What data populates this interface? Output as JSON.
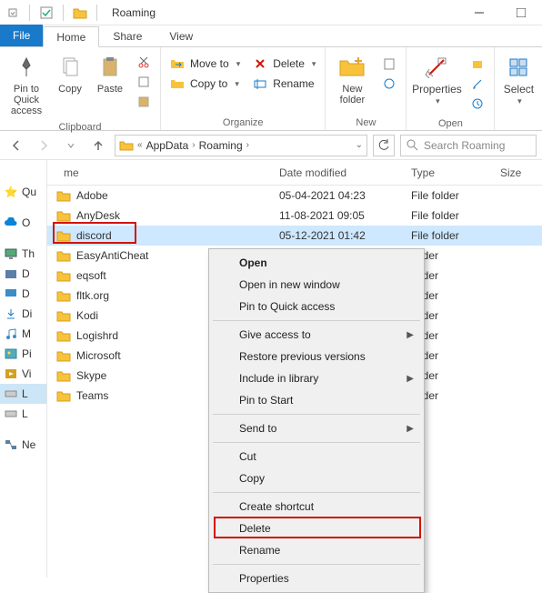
{
  "titlebar": {
    "title": "Roaming"
  },
  "tabs": {
    "file": "File",
    "home": "Home",
    "share": "Share",
    "view": "View"
  },
  "ribbon": {
    "clipboard": {
      "label": "Clipboard",
      "pin": "Pin to Quick access",
      "copy": "Copy",
      "paste": "Paste"
    },
    "organize": {
      "label": "Organize",
      "move_to": "Move to",
      "copy_to": "Copy to",
      "delete": "Delete",
      "rename": "Rename"
    },
    "new": {
      "label": "New",
      "new_folder": "New folder"
    },
    "open": {
      "label": "Open",
      "properties": "Properties"
    },
    "select": {
      "label": "Select",
      "select": "Select"
    }
  },
  "breadcrumb": {
    "parts": [
      "AppData",
      "Roaming"
    ]
  },
  "search": {
    "placeholder": "Search Roaming"
  },
  "sidebar": {
    "items": [
      {
        "label": "Qu"
      },
      {
        "label": "O"
      },
      {
        "label": "Th"
      },
      {
        "label": "D"
      },
      {
        "label": "D"
      },
      {
        "label": "Di"
      },
      {
        "label": "M"
      },
      {
        "label": "Pi"
      },
      {
        "label": "Vi"
      },
      {
        "label": "L"
      },
      {
        "label": "L"
      },
      {
        "label": "Ne"
      }
    ]
  },
  "columns": {
    "name": "me",
    "date": "Date modified",
    "type": "Type",
    "size": "Size"
  },
  "files": [
    {
      "name": "Adobe",
      "date": "05-04-2021 04:23",
      "type": "File folder"
    },
    {
      "name": "AnyDesk",
      "date": "11-08-2021 09:05",
      "type": "File folder"
    },
    {
      "name": "discord",
      "date": "05-12-2021 01:42",
      "type": "File folder",
      "selected": true
    },
    {
      "name": "EasyAntiCheat",
      "date": "",
      "type": "folder"
    },
    {
      "name": "eqsoft",
      "date": "",
      "type": "folder"
    },
    {
      "name": "fltk.org",
      "date": "",
      "type": "folder"
    },
    {
      "name": "Kodi",
      "date": "",
      "type": "folder"
    },
    {
      "name": "Logishrd",
      "date": "",
      "type": "folder"
    },
    {
      "name": "Microsoft",
      "date": "",
      "type": "folder"
    },
    {
      "name": "Skype",
      "date": "",
      "type": "folder"
    },
    {
      "name": "Teams",
      "date": "",
      "type": "folder"
    }
  ],
  "context_menu": {
    "open": "Open",
    "open_new": "Open in new window",
    "pin_quick": "Pin to Quick access",
    "give_access": "Give access to",
    "restore": "Restore previous versions",
    "include_lib": "Include in library",
    "pin_start": "Pin to Start",
    "send_to": "Send to",
    "cut": "Cut",
    "copy": "Copy",
    "create_shortcut": "Create shortcut",
    "delete": "Delete",
    "rename": "Rename",
    "properties": "Properties"
  }
}
